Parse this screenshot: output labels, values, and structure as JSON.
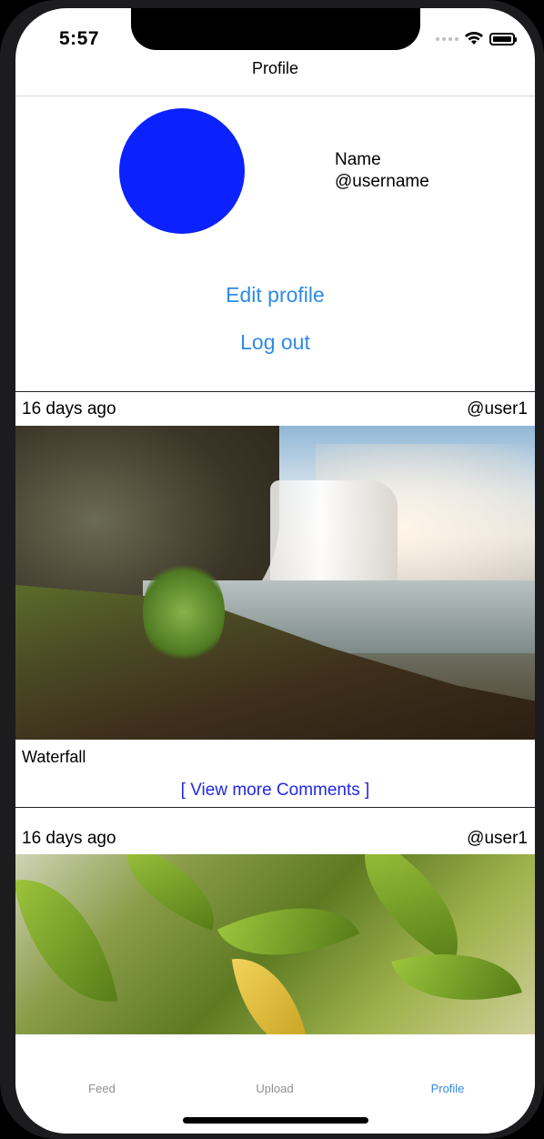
{
  "status_bar": {
    "time": "5:57"
  },
  "nav": {
    "title": "Profile"
  },
  "profile": {
    "name": "Name",
    "username": "@username",
    "avatar_color": "#0b22ff",
    "edit_label": "Edit profile",
    "logout_label": "Log out"
  },
  "posts": [
    {
      "time": "16 days ago",
      "user": "@user1",
      "image_icon": "waterfall-photo",
      "caption": "Waterfall",
      "comments_link": "[ View more Comments ]"
    },
    {
      "time": "16 days ago",
      "user": "@user1",
      "image_icon": "leaves-photo"
    }
  ],
  "tab_bar": {
    "tabs": [
      {
        "label": "Feed"
      },
      {
        "label": "Upload"
      },
      {
        "label": "Profile"
      }
    ],
    "active": "Profile",
    "accent_color": "#2f8be6"
  },
  "colors": {
    "link_blue": "#2f8be6",
    "comments_blue": "#2128e8"
  }
}
